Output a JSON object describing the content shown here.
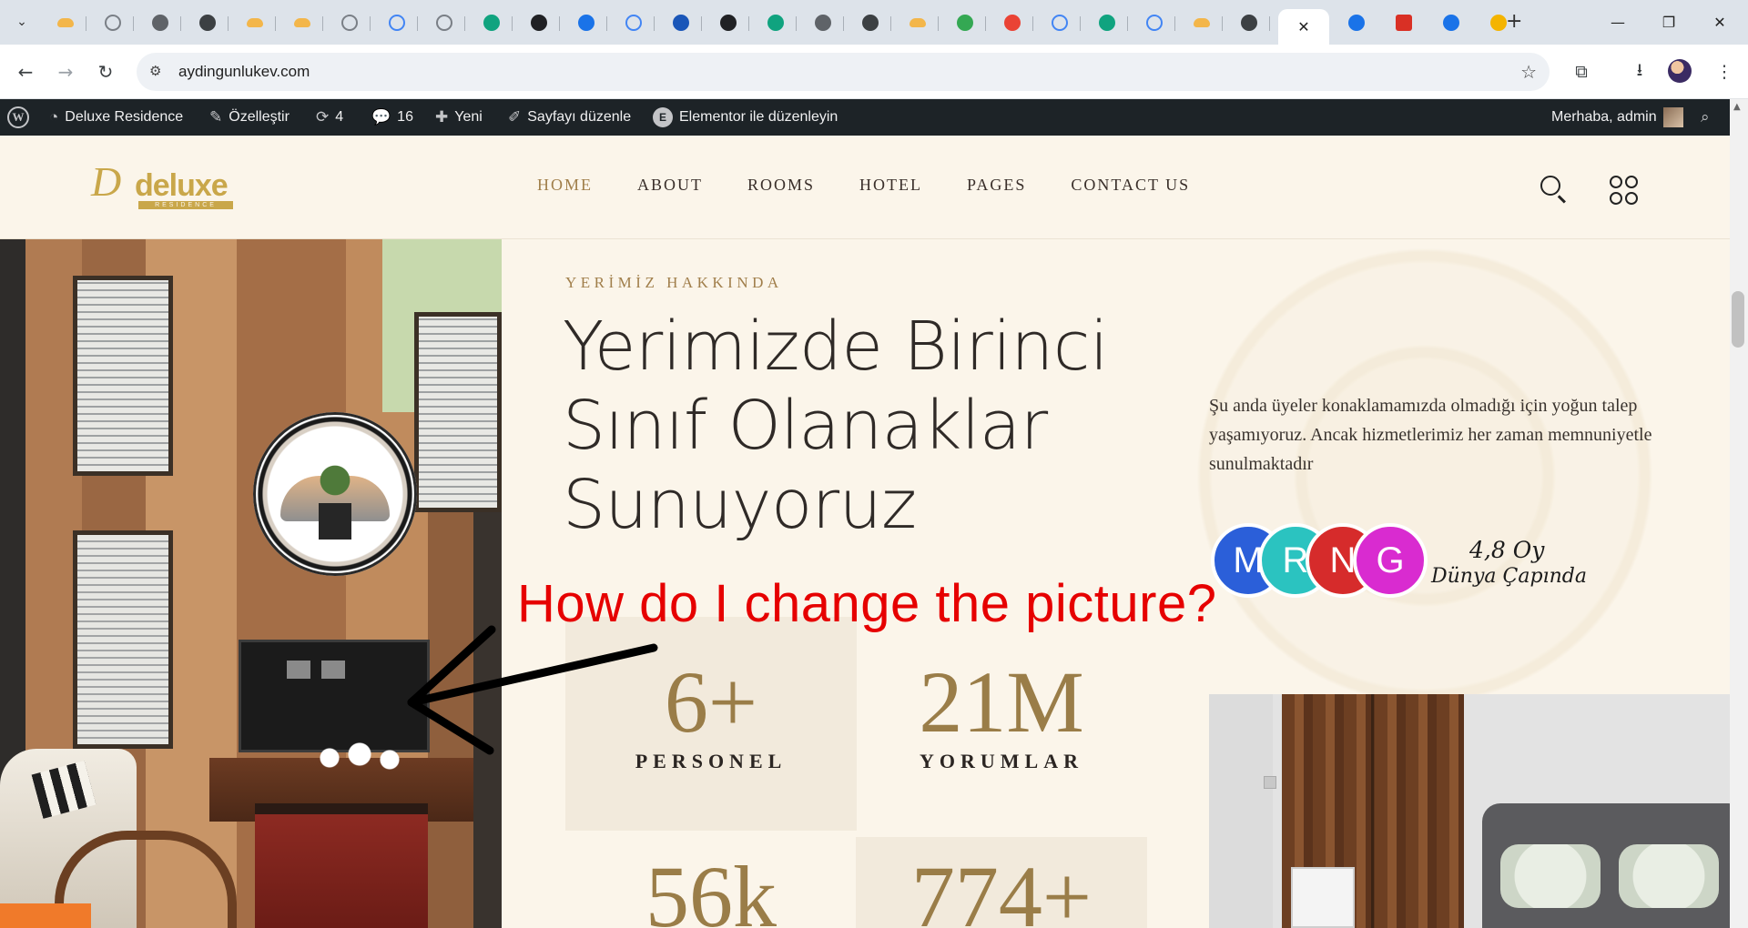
{
  "browser": {
    "url": "aydingunlukev.com",
    "tab_favicons": [
      "cloud-icon",
      "loading-icon",
      "openai-icon",
      "globe-icon",
      "cloud-icon",
      "cloud-icon",
      "loading-icon",
      "google-icon",
      "loading-icon",
      "chatgpt-icon",
      "circle-icon",
      "translate-icon",
      "google-icon",
      "repo-icon",
      "circle-icon",
      "chatgpt-icon",
      "openai-icon",
      "globe-icon",
      "cloud-icon",
      "maps-icon",
      "maps-pin-icon",
      "google-icon",
      "chatgpt-icon",
      "google-icon",
      "cloud-icon",
      "globe-icon"
    ],
    "active_tab_close": "✕",
    "after_active_favicons": [
      "translate-icon",
      "one-icon",
      "puzzle-icon",
      "rainbow-icon"
    ],
    "new_tab": "+",
    "window_controls": [
      "—",
      "❐",
      "✕"
    ]
  },
  "wpbar": {
    "site_name": "Deluxe Residence",
    "customize": "Özelleştir",
    "updates_count": "4",
    "comments_count": "16",
    "new": "Yeni",
    "edit_page": "Sayfayı düzenle",
    "elementor": "Elementor ile düzenleyin",
    "greeting": "Merhaba, admin"
  },
  "site": {
    "logo_word": "deluxe",
    "logo_sub": "RESIDENCE",
    "nav": [
      {
        "label": "HOME",
        "active": true
      },
      {
        "label": "ABOUT",
        "active": false
      },
      {
        "label": "ROOMS",
        "active": false
      },
      {
        "label": "HOTEL",
        "active": false
      },
      {
        "label": "PAGES",
        "active": false
      },
      {
        "label": "CONTACT US",
        "active": false
      }
    ]
  },
  "about": {
    "eyebrow": "YERİMİZ HAKKINDA",
    "headline_1": "Yerimizde Birinci",
    "headline_2": "Sınıf Olanaklar",
    "headline_3": "Sunuyoruz",
    "intro": "Şu anda üyeler konaklamamızda olmadığı için yoğun talep yaşamıyoruz. Ancak hizmetlerimiz her zaman memnuniyetle sunulmaktadır",
    "badges": [
      {
        "letter": "M",
        "color": "#2b5fd9"
      },
      {
        "letter": "R",
        "color": "#2bc3c0"
      },
      {
        "letter": "N",
        "color": "#d62b2b"
      },
      {
        "letter": "G",
        "color": "#d92bd0"
      }
    ],
    "rating_value": "4,8 Oy",
    "rating_caption": "Dünya Çapında",
    "stats": [
      {
        "value": "6+",
        "label": "PERSONEL"
      },
      {
        "value": "21M",
        "label": "YORUMLAR"
      },
      {
        "value": "56k",
        "label": ""
      },
      {
        "value": "774+",
        "label": ""
      }
    ]
  },
  "annotation": {
    "text": "How do I change the picture?"
  },
  "colors": {
    "accent_gold": "#a07e4a",
    "annotation_red": "#e60000",
    "wpbar_bg": "#1d2327",
    "page_bg": "#fbf5ea"
  }
}
